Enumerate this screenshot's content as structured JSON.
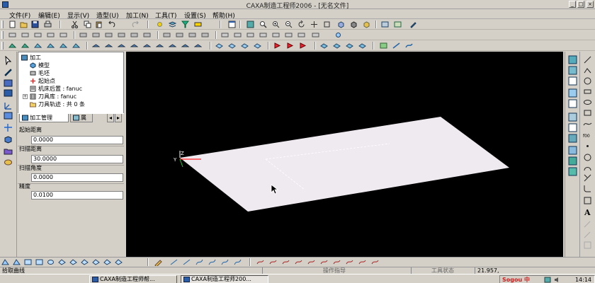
{
  "window": {
    "title": "CAXA制造工程师2006 - [无名文件]",
    "controls": [
      "minimize-icon",
      "maximize-icon",
      "close-icon"
    ]
  },
  "menu": [
    "文件(F)",
    "编辑(E)",
    "显示(V)",
    "造型(U)",
    "加工(N)",
    "工具(T)",
    "设置(S)",
    "帮助(H)"
  ],
  "tree": {
    "root": "加工",
    "items": [
      {
        "label": "模型",
        "icon": "model-icon"
      },
      {
        "label": "毛坯",
        "icon": "blank-stock-icon"
      },
      {
        "label": "起始点",
        "icon": "start-point-icon"
      },
      {
        "label": "机床后置 : fanuc",
        "icon": "machine-post-icon"
      },
      {
        "label": "刀具库 : fanuc",
        "icon": "tool-library-icon"
      },
      {
        "label": "刀具轨迹 : 共 0 条",
        "icon": "toolpath-folder-icon"
      }
    ]
  },
  "tabs": {
    "tab1": "加工管理",
    "tab2": "属"
  },
  "properties": [
    {
      "label": "起始距离",
      "value": "0.0000"
    },
    {
      "label": "扫描距离",
      "value": "30.0000"
    },
    {
      "label": "扫描角度",
      "value": "0.0000"
    },
    {
      "label": "精度",
      "value": "0.0100"
    }
  ],
  "viewport": {
    "background": "#000000",
    "plane_color": "#efe9f0",
    "axis_x_color": "#ff2020",
    "axis_label_z": "Z",
    "axis_label_y": "Y"
  },
  "status": {
    "prompt": "拾取曲线",
    "op_hint": "操作指导",
    "tool_state": "工具状态",
    "coords": "21.957,"
  },
  "taskbar": {
    "tasks": [
      {
        "label": "CAXA制造工程师帮...",
        "active": false
      },
      {
        "label": "CAXA制造工程师200...",
        "active": true
      }
    ],
    "ime": "Sogou 中",
    "clock": "14:14"
  }
}
